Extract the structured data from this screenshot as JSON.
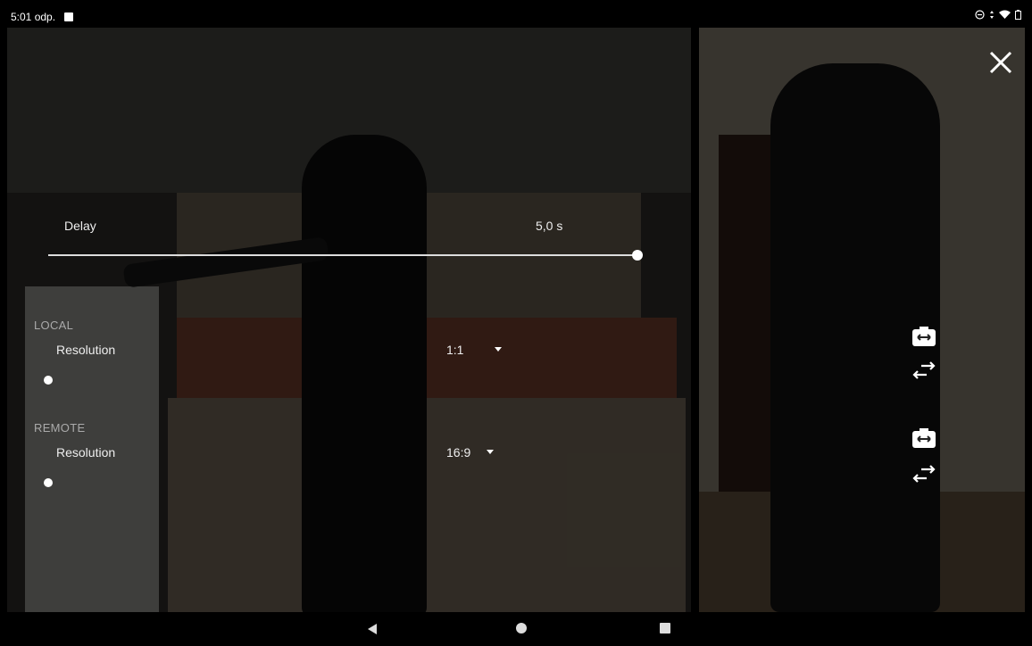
{
  "status": {
    "time": "5:01 odp."
  },
  "settings": {
    "delay_label": "Delay",
    "delay_value": "5,0 s",
    "delay_fraction": 1.0,
    "local_header": "LOCAL",
    "local_resolution_label": "Resolution",
    "local_resolution_value": "1:1",
    "remote_header": "REMOTE",
    "remote_resolution_label": "Resolution",
    "remote_resolution_value": "16:9"
  },
  "icons": {
    "close": "close-icon",
    "switch_camera": "switch-camera-icon",
    "swap": "swap-horizontal-icon",
    "nav_back": "back-triangle-icon",
    "nav_home": "home-circle-icon",
    "nav_recents": "recents-square-icon"
  },
  "colors": {
    "overlay": "#000000",
    "text": "#ffffff",
    "muted": "#aaaaaa"
  }
}
